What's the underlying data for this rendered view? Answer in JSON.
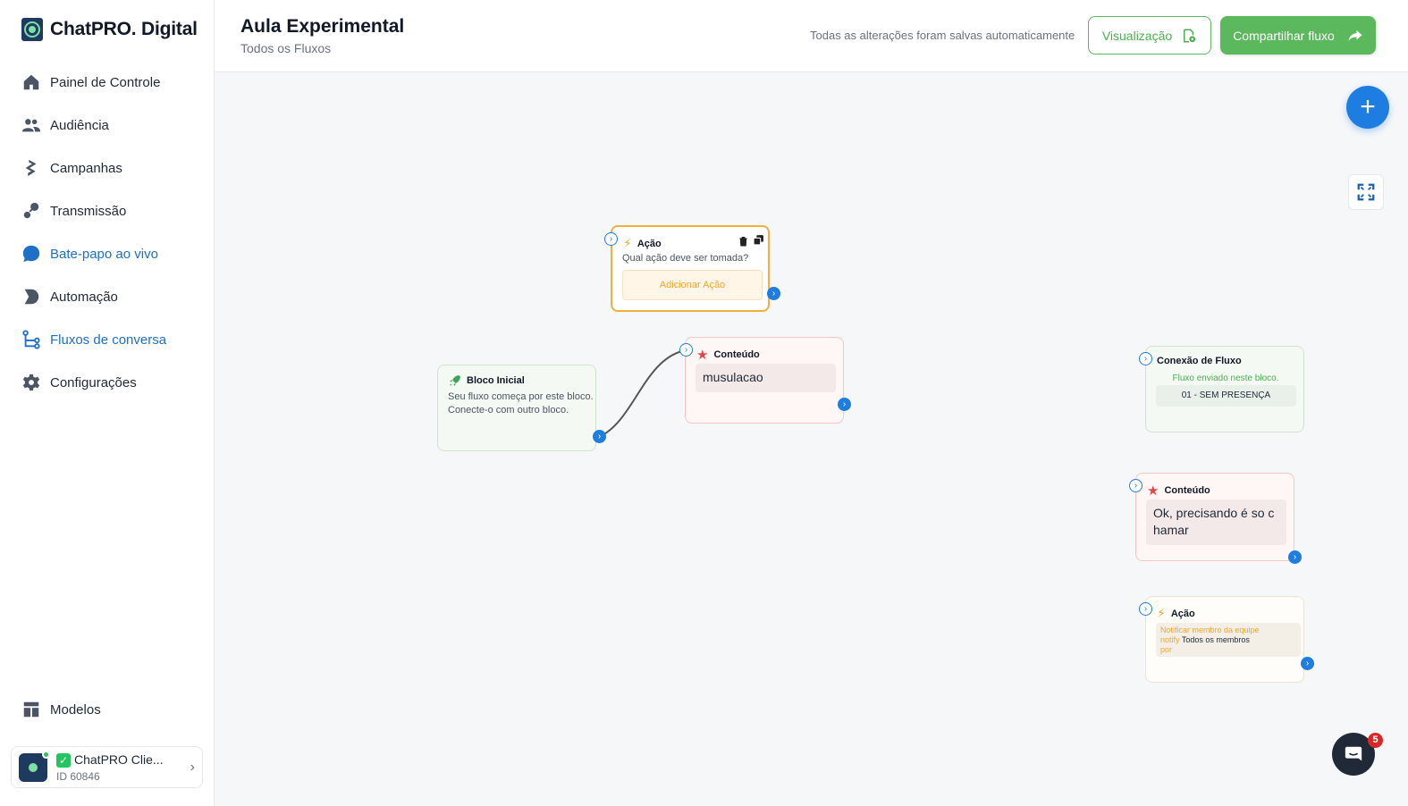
{
  "brand": {
    "name": "ChatPRO. Digital"
  },
  "sidebar": {
    "items": [
      {
        "label": "Painel de Controle",
        "icon": "home-icon"
      },
      {
        "label": "Audiência",
        "icon": "users-icon"
      },
      {
        "label": "Campanhas",
        "icon": "campaign-icon"
      },
      {
        "label": "Transmissão",
        "icon": "broadcast-icon"
      },
      {
        "label": "Bate-papo ao vivo",
        "icon": "chat-bubble-icon",
        "active": true
      },
      {
        "label": "Automação",
        "icon": "automation-icon"
      },
      {
        "label": "Fluxos de conversa",
        "icon": "flow-icon",
        "active": true
      },
      {
        "label": "Configurações",
        "icon": "gear-icon"
      }
    ],
    "templates": {
      "label": "Modelos",
      "icon": "templates-icon"
    },
    "account": {
      "name": "ChatPRO Clie...",
      "id_label": "ID 60846"
    }
  },
  "header": {
    "title": "Aula Experimental",
    "breadcrumb": "Todos os Fluxos",
    "autosave": "Todas as alterações foram salvas automaticamente",
    "preview_label": "Visualização",
    "share_label": "Compartilhar fluxo"
  },
  "canvas": {
    "chat_badge": "5",
    "nodes": {
      "start": {
        "title": "Bloco Inicial",
        "line1": "Seu fluxo começa por este bloco.",
        "line2": "Conecte-o com outro bloco."
      },
      "action1": {
        "title": "Ação",
        "question": "Qual ação deve ser tomada?",
        "add_label": "Adicionar Ação"
      },
      "content1": {
        "title": "Conteúdo",
        "message": "musulacao"
      },
      "flowconn": {
        "title": "Conexão de Fluxo",
        "subtitle": "Fluxo enviado neste bloco.",
        "flow_name": "01 - SEM PRESENÇA"
      },
      "content2": {
        "title": "Conteúdo",
        "message": "Ok, precisando é so c hamar"
      },
      "action2": {
        "title": "Ação",
        "line1": "Notificar membro da equipe",
        "line2_prefix": "notify",
        "line2_value": "Todos os membros",
        "line3": "por"
      }
    }
  },
  "colors": {
    "primary": "#1e7de0",
    "green": "#5cb85c",
    "active_nav": "#1d6fc7",
    "action_border": "#f0b040"
  }
}
